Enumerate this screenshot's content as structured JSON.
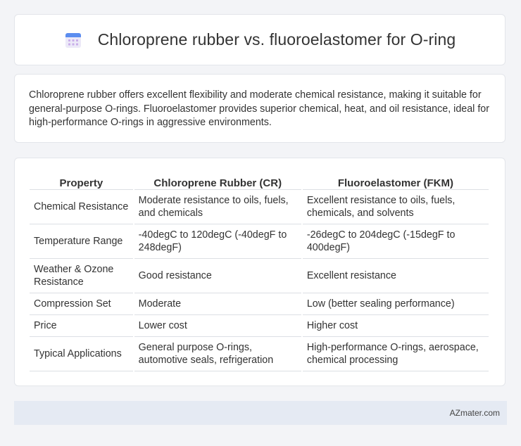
{
  "header": {
    "title": "Chloroprene rubber vs. fluoroelastomer for O-ring",
    "icon": "calendar-grid-icon",
    "icon_colors": {
      "top": "#5b8def",
      "body": "#e8e6f7",
      "dots": "#c7a9e8"
    }
  },
  "summary": {
    "text": "Chloroprene rubber offers excellent flexibility and moderate chemical resistance, making it suitable for general-purpose O-rings. Fluoroelastomer provides superior chemical, heat, and oil resistance, ideal for high-performance O-rings in aggressive environments."
  },
  "table": {
    "headers": [
      "Property",
      "Chloroprene Rubber (CR)",
      "Fluoroelastomer (FKM)"
    ],
    "rows": [
      [
        "Chemical Resistance",
        "Moderate resistance to oils, fuels, and chemicals",
        "Excellent resistance to oils, fuels, chemicals, and solvents"
      ],
      [
        "Temperature Range",
        "-40degC to 120degC (-40degF to 248degF)",
        "-26degC to 204degC (-15degF to 400degF)"
      ],
      [
        "Weather & Ozone Resistance",
        "Good resistance",
        "Excellent resistance"
      ],
      [
        "Compression Set",
        "Moderate",
        "Low (better sealing performance)"
      ],
      [
        "Price",
        "Lower cost",
        "Higher cost"
      ],
      [
        "Typical Applications",
        "General purpose O-rings, automotive seals, refrigeration",
        "High-performance O-rings, aerospace, chemical processing"
      ]
    ]
  },
  "footer": {
    "text": "AZmater.com"
  }
}
